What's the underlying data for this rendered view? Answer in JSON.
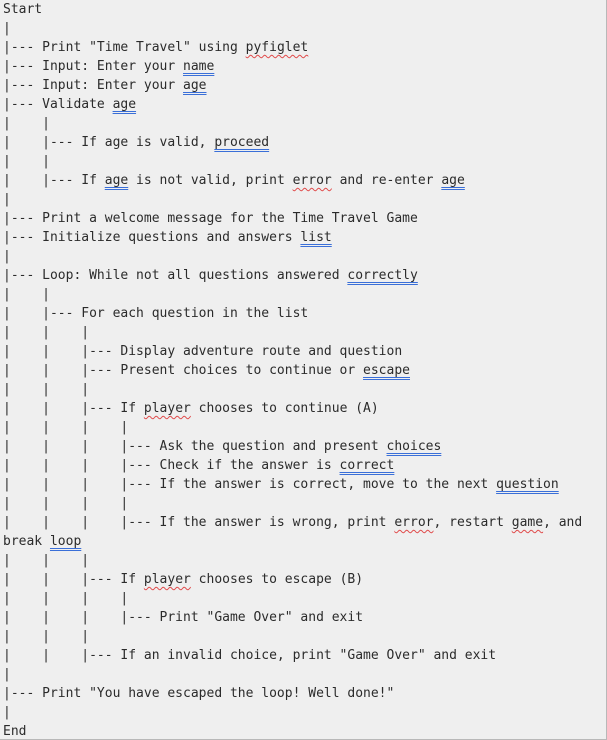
{
  "pseudocode": {
    "lines": [
      [
        {
          "t": "Start"
        }
      ],
      [
        {
          "t": "|"
        }
      ],
      [
        {
          "t": "|--- Print \"Time Travel\" using "
        },
        {
          "t": "pyfiglet",
          "u": "red"
        }
      ],
      [
        {
          "t": "|--- Input: Enter your "
        },
        {
          "t": "name",
          "u": "blue"
        }
      ],
      [
        {
          "t": "|--- Input: Enter your "
        },
        {
          "t": "age",
          "u": "blue"
        }
      ],
      [
        {
          "t": "|--- Validate "
        },
        {
          "t": "age",
          "u": "blue"
        }
      ],
      [
        {
          "t": "|    |"
        }
      ],
      [
        {
          "t": "|    |--- If age is valid, "
        },
        {
          "t": "proceed",
          "u": "blue"
        }
      ],
      [
        {
          "t": "|    |"
        }
      ],
      [
        {
          "t": "|    |--- If "
        },
        {
          "t": "age",
          "u": "blue"
        },
        {
          "t": " is not valid, print "
        },
        {
          "t": "error",
          "u": "red"
        },
        {
          "t": " and re-enter "
        },
        {
          "t": "age",
          "u": "blue"
        }
      ],
      [
        {
          "t": "|"
        }
      ],
      [
        {
          "t": "|--- Print a welcome message for the Time Travel Game"
        }
      ],
      [
        {
          "t": "|--- Initialize questions and answers "
        },
        {
          "t": "list",
          "u": "blue"
        }
      ],
      [
        {
          "t": "|"
        }
      ],
      [
        {
          "t": "|--- Loop: While not all questions answered "
        },
        {
          "t": "correctly",
          "u": "blue"
        }
      ],
      [
        {
          "t": "|    |"
        }
      ],
      [
        {
          "t": "|    |--- For each question in the list"
        }
      ],
      [
        {
          "t": "|    |    |"
        }
      ],
      [
        {
          "t": "|    |    |--- Display adventure route and question"
        }
      ],
      [
        {
          "t": "|    |    |--- Present choices to continue or "
        },
        {
          "t": "escape",
          "u": "blue"
        }
      ],
      [
        {
          "t": "|    |    |"
        }
      ],
      [
        {
          "t": "|    |    |--- If "
        },
        {
          "t": "player",
          "u": "red"
        },
        {
          "t": " chooses to continue (A)"
        }
      ],
      [
        {
          "t": "|    |    |    |"
        }
      ],
      [
        {
          "t": "|    |    |    |--- Ask the question and present "
        },
        {
          "t": "choices",
          "u": "blue"
        }
      ],
      [
        {
          "t": "|    |    |    |--- Check if the answer is "
        },
        {
          "t": "correct",
          "u": "blue"
        }
      ],
      [
        {
          "t": "|    |    |    |--- If the answer is correct, move to the next "
        },
        {
          "t": "question",
          "u": "blue"
        }
      ],
      [
        {
          "t": "|    |    |    |"
        }
      ],
      [
        {
          "t": "|    |    |    |--- If the answer is wrong, print "
        },
        {
          "t": "error",
          "u": "red"
        },
        {
          "t": ", restart "
        },
        {
          "t": "game",
          "u": "red"
        },
        {
          "t": ", and"
        }
      ],
      [
        {
          "t": "break "
        },
        {
          "t": "loop",
          "u": "blue"
        }
      ],
      [
        {
          "t": "|    |    |"
        }
      ],
      [
        {
          "t": "|    |    |--- If "
        },
        {
          "t": "player",
          "u": "red"
        },
        {
          "t": " chooses to escape (B)"
        }
      ],
      [
        {
          "t": "|    |    |    |"
        }
      ],
      [
        {
          "t": "|    |    |    |--- Print \"Game Over\" and exit"
        }
      ],
      [
        {
          "t": "|    |    |"
        }
      ],
      [
        {
          "t": "|    |    |--- If an invalid choice, print \"Game Over\" and exit"
        }
      ],
      [
        {
          "t": "|"
        }
      ],
      [
        {
          "t": "|--- Print \"You have escaped the loop! Well done!\""
        }
      ],
      [
        {
          "t": "|"
        }
      ],
      [
        {
          "t": "End"
        }
      ]
    ]
  }
}
